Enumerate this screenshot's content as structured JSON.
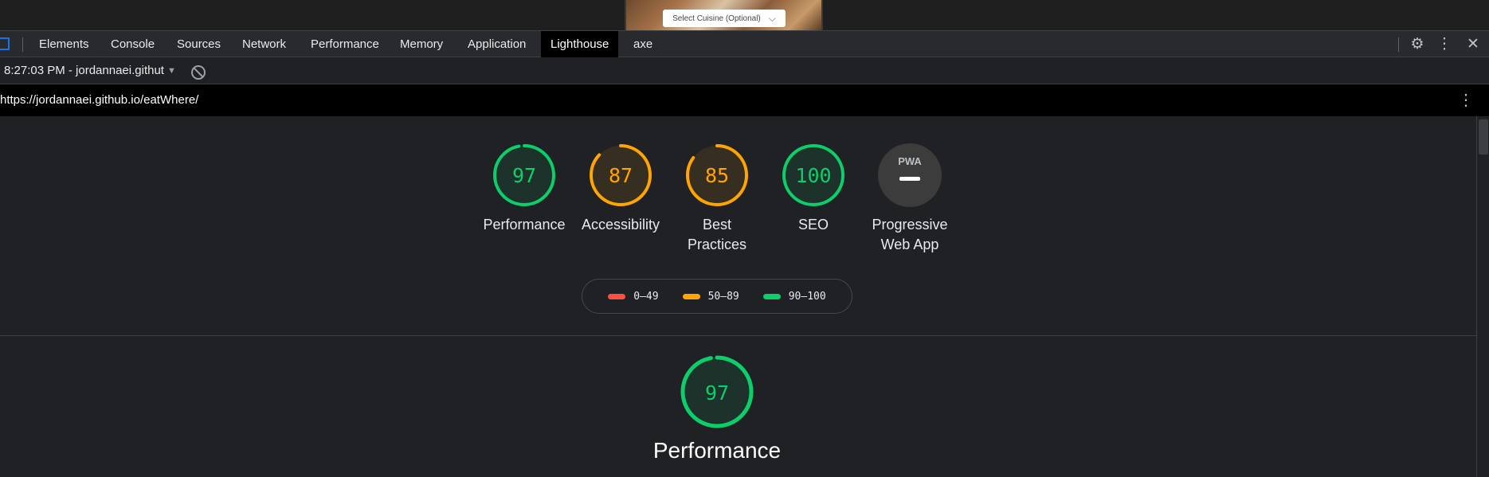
{
  "page_preview": {
    "cuisine_select": "Select Cuisine (Optional)"
  },
  "devtools": {
    "tabs": [
      {
        "label": "Elements",
        "active": false
      },
      {
        "label": "Console",
        "active": false
      },
      {
        "label": "Sources",
        "active": false
      },
      {
        "label": "Network",
        "active": false
      },
      {
        "label": "Performance",
        "active": false
      },
      {
        "label": "Memory",
        "active": false
      },
      {
        "label": "Application",
        "active": false
      },
      {
        "label": "Lighthouse",
        "active": true
      },
      {
        "label": "axe",
        "active": false
      }
    ],
    "right_icons": [
      "gear-icon",
      "kebab-menu-icon",
      "close-icon"
    ]
  },
  "report_bar": {
    "selected_report": "8:27:03 PM - jordannaei.githut"
  },
  "url_bar": {
    "url": "https://jordannaei.github.io/eatWhere/"
  },
  "scores": [
    {
      "name": "Performance",
      "score": "97",
      "level": "pass",
      "fraction": 0.97
    },
    {
      "name": "Accessibility",
      "score": "87",
      "level": "average",
      "fraction": 0.87
    },
    {
      "name": "Best Practices",
      "score": "85",
      "level": "average",
      "fraction": 0.85
    },
    {
      "name": "SEO",
      "score": "100",
      "level": "pass",
      "fraction": 1.0
    },
    {
      "name": "Progressive Web App",
      "badge": "PWA",
      "level": "na"
    }
  ],
  "legend": [
    {
      "range": "0–49",
      "color": "#ff4e42"
    },
    {
      "range": "50–89",
      "color": "#ffa400"
    },
    {
      "range": "90–100",
      "color": "#0cce6b"
    }
  ],
  "colors": {
    "pass": "#0cce6b",
    "average": "#ffa400",
    "fail": "#ff4e42"
  },
  "section": {
    "score": "97",
    "fraction": 0.97,
    "title": "Performance"
  }
}
